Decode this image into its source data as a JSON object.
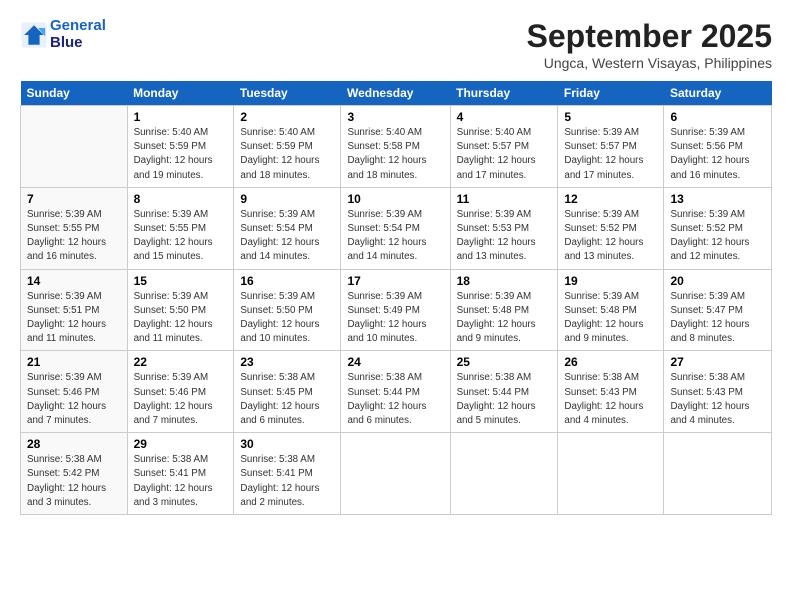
{
  "header": {
    "logo_line1": "General",
    "logo_line2": "Blue",
    "month": "September 2025",
    "location": "Ungca, Western Visayas, Philippines"
  },
  "days_of_week": [
    "Sunday",
    "Monday",
    "Tuesday",
    "Wednesday",
    "Thursday",
    "Friday",
    "Saturday"
  ],
  "weeks": [
    [
      {
        "day": "",
        "info": ""
      },
      {
        "day": "1",
        "info": "Sunrise: 5:40 AM\nSunset: 5:59 PM\nDaylight: 12 hours\nand 19 minutes."
      },
      {
        "day": "2",
        "info": "Sunrise: 5:40 AM\nSunset: 5:59 PM\nDaylight: 12 hours\nand 18 minutes."
      },
      {
        "day": "3",
        "info": "Sunrise: 5:40 AM\nSunset: 5:58 PM\nDaylight: 12 hours\nand 18 minutes."
      },
      {
        "day": "4",
        "info": "Sunrise: 5:40 AM\nSunset: 5:57 PM\nDaylight: 12 hours\nand 17 minutes."
      },
      {
        "day": "5",
        "info": "Sunrise: 5:39 AM\nSunset: 5:57 PM\nDaylight: 12 hours\nand 17 minutes."
      },
      {
        "day": "6",
        "info": "Sunrise: 5:39 AM\nSunset: 5:56 PM\nDaylight: 12 hours\nand 16 minutes."
      }
    ],
    [
      {
        "day": "7",
        "info": "Sunrise: 5:39 AM\nSunset: 5:55 PM\nDaylight: 12 hours\nand 16 minutes."
      },
      {
        "day": "8",
        "info": "Sunrise: 5:39 AM\nSunset: 5:55 PM\nDaylight: 12 hours\nand 15 minutes."
      },
      {
        "day": "9",
        "info": "Sunrise: 5:39 AM\nSunset: 5:54 PM\nDaylight: 12 hours\nand 14 minutes."
      },
      {
        "day": "10",
        "info": "Sunrise: 5:39 AM\nSunset: 5:54 PM\nDaylight: 12 hours\nand 14 minutes."
      },
      {
        "day": "11",
        "info": "Sunrise: 5:39 AM\nSunset: 5:53 PM\nDaylight: 12 hours\nand 13 minutes."
      },
      {
        "day": "12",
        "info": "Sunrise: 5:39 AM\nSunset: 5:52 PM\nDaylight: 12 hours\nand 13 minutes."
      },
      {
        "day": "13",
        "info": "Sunrise: 5:39 AM\nSunset: 5:52 PM\nDaylight: 12 hours\nand 12 minutes."
      }
    ],
    [
      {
        "day": "14",
        "info": "Sunrise: 5:39 AM\nSunset: 5:51 PM\nDaylight: 12 hours\nand 11 minutes."
      },
      {
        "day": "15",
        "info": "Sunrise: 5:39 AM\nSunset: 5:50 PM\nDaylight: 12 hours\nand 11 minutes."
      },
      {
        "day": "16",
        "info": "Sunrise: 5:39 AM\nSunset: 5:50 PM\nDaylight: 12 hours\nand 10 minutes."
      },
      {
        "day": "17",
        "info": "Sunrise: 5:39 AM\nSunset: 5:49 PM\nDaylight: 12 hours\nand 10 minutes."
      },
      {
        "day": "18",
        "info": "Sunrise: 5:39 AM\nSunset: 5:48 PM\nDaylight: 12 hours\nand 9 minutes."
      },
      {
        "day": "19",
        "info": "Sunrise: 5:39 AM\nSunset: 5:48 PM\nDaylight: 12 hours\nand 9 minutes."
      },
      {
        "day": "20",
        "info": "Sunrise: 5:39 AM\nSunset: 5:47 PM\nDaylight: 12 hours\nand 8 minutes."
      }
    ],
    [
      {
        "day": "21",
        "info": "Sunrise: 5:39 AM\nSunset: 5:46 PM\nDaylight: 12 hours\nand 7 minutes."
      },
      {
        "day": "22",
        "info": "Sunrise: 5:39 AM\nSunset: 5:46 PM\nDaylight: 12 hours\nand 7 minutes."
      },
      {
        "day": "23",
        "info": "Sunrise: 5:38 AM\nSunset: 5:45 PM\nDaylight: 12 hours\nand 6 minutes."
      },
      {
        "day": "24",
        "info": "Sunrise: 5:38 AM\nSunset: 5:44 PM\nDaylight: 12 hours\nand 6 minutes."
      },
      {
        "day": "25",
        "info": "Sunrise: 5:38 AM\nSunset: 5:44 PM\nDaylight: 12 hours\nand 5 minutes."
      },
      {
        "day": "26",
        "info": "Sunrise: 5:38 AM\nSunset: 5:43 PM\nDaylight: 12 hours\nand 4 minutes."
      },
      {
        "day": "27",
        "info": "Sunrise: 5:38 AM\nSunset: 5:43 PM\nDaylight: 12 hours\nand 4 minutes."
      }
    ],
    [
      {
        "day": "28",
        "info": "Sunrise: 5:38 AM\nSunset: 5:42 PM\nDaylight: 12 hours\nand 3 minutes."
      },
      {
        "day": "29",
        "info": "Sunrise: 5:38 AM\nSunset: 5:41 PM\nDaylight: 12 hours\nand 3 minutes."
      },
      {
        "day": "30",
        "info": "Sunrise: 5:38 AM\nSunset: 5:41 PM\nDaylight: 12 hours\nand 2 minutes."
      },
      {
        "day": "",
        "info": ""
      },
      {
        "day": "",
        "info": ""
      },
      {
        "day": "",
        "info": ""
      },
      {
        "day": "",
        "info": ""
      }
    ]
  ]
}
